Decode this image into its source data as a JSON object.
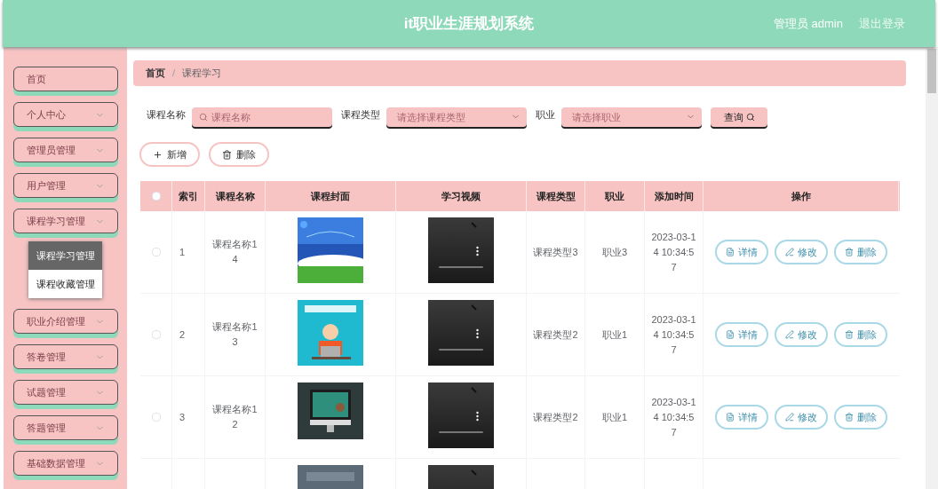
{
  "header": {
    "title": "it职业生涯规划系统",
    "user": "管理员 admin",
    "logout": "退出登录"
  },
  "sidebar": {
    "items": [
      {
        "label": "首页",
        "expandable": false
      },
      {
        "label": "个人中心",
        "expandable": true
      },
      {
        "label": "管理员管理",
        "expandable": true
      },
      {
        "label": "用户管理",
        "expandable": true
      },
      {
        "label": "课程学习管理",
        "expandable": true,
        "children": [
          {
            "label": "课程学习管理",
            "selected": true
          },
          {
            "label": "课程收藏管理",
            "selected": false
          }
        ]
      },
      {
        "label": "职业介绍管理",
        "expandable": true
      },
      {
        "label": "答卷管理",
        "expandable": true
      },
      {
        "label": "试题管理",
        "expandable": true
      },
      {
        "label": "答题管理",
        "expandable": true
      },
      {
        "label": "基础数据管理",
        "expandable": true
      }
    ]
  },
  "breadcrumb": {
    "items": [
      "首页",
      "课程学习"
    ],
    "separator": "/"
  },
  "search": {
    "fields": [
      {
        "label": "课程名称",
        "kind": "text",
        "placeholder": "课程名称"
      },
      {
        "label": "课程类型",
        "kind": "select",
        "placeholder": "请选择课程类型"
      },
      {
        "label": "职业",
        "kind": "select",
        "placeholder": "请选择职业"
      }
    ],
    "button": "查询"
  },
  "toolbar": [
    {
      "label": "新增",
      "kind": "add"
    },
    {
      "label": "删除",
      "kind": "delete"
    }
  ],
  "table": {
    "select_all": {
      "checked": false
    },
    "columns": [
      "索引",
      "课程名称",
      "课程封面",
      "学习视频",
      "课程类型",
      "职业",
      "添加时间",
      "操作"
    ],
    "rows": [
      {
        "checked": false,
        "index": "1",
        "name": "课程名称14",
        "cover": {
          "kind": "picture"
        },
        "type": "课程类型3",
        "job": "职业3",
        "time": "2023-03-14 10:34:57",
        "actions": [
          {
            "label": "详情",
            "kind": "detail"
          },
          {
            "label": "修改",
            "kind": "edit"
          },
          {
            "label": "删除",
            "kind": "delete"
          }
        ]
      },
      {
        "checked": false,
        "index": "2",
        "name": "课程名称13",
        "cover": {
          "kind": "picture"
        },
        "type": "课程类型2",
        "job": "职业1",
        "time": "2023-03-14 10:34:57",
        "actions": [
          {
            "label": "详情",
            "kind": "detail"
          },
          {
            "label": "修改",
            "kind": "edit"
          },
          {
            "label": "删除",
            "kind": "delete"
          }
        ]
      },
      {
        "checked": false,
        "index": "3",
        "name": "课程名称12",
        "cover": {
          "kind": "picture"
        },
        "type": "课程类型2",
        "job": "职业1",
        "time": "2023-03-14 10:34:57",
        "actions": [
          {
            "label": "详情",
            "kind": "detail"
          },
          {
            "label": "修改",
            "kind": "edit"
          },
          {
            "label": "删除",
            "kind": "delete"
          }
        ]
      },
      {
        "cover": {
          "kind": "picture"
        }
      }
    ]
  }
}
